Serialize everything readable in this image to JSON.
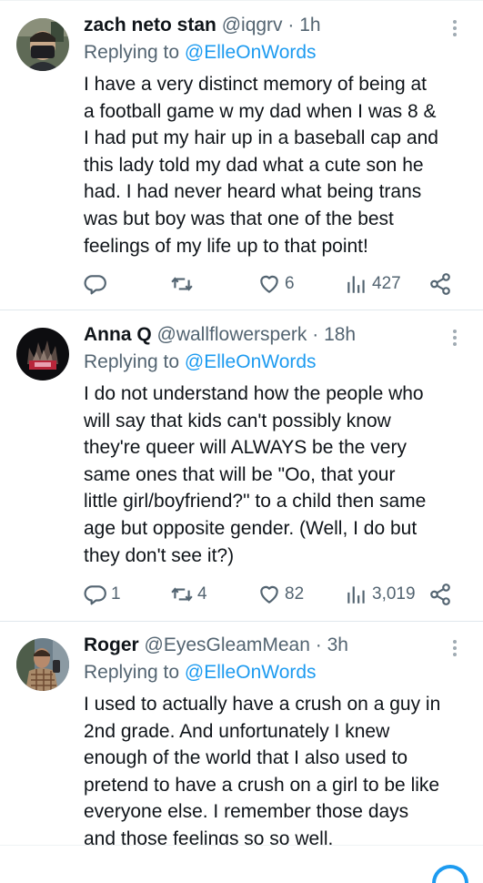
{
  "tweets": [
    {
      "name": "zach neto stan",
      "handle": "@iqgrv",
      "dot": "·",
      "time": "1h",
      "replying_prefix": "Replying to ",
      "replying_to": "@ElleOnWords",
      "body_lines": [
        "I have a very distinct memory of being at",
        "a football game w my dad when I was 8 &",
        "I had put my hair up in a baseball cap and",
        "this lady told my dad what a cute son he",
        "had. I had never heard what being trans",
        "was but boy was that one of the best",
        "feelings of my life up to that point!"
      ],
      "replies": "",
      "retweets": "",
      "likes": "6",
      "views": "427"
    },
    {
      "name": "Anna Q",
      "handle": "@wallflowersperk",
      "dot": "·",
      "time": "18h",
      "replying_prefix": "Replying to ",
      "replying_to": "@ElleOnWords",
      "body_lines": [
        "I do not understand how the people who",
        "will say that kids can't possibly know",
        "they're queer will ALWAYS be the very",
        "same ones that will be \"Oo, that your",
        "little girl/boyfriend?\" to a child then same",
        "age but opposite gender. (Well, I do but",
        "they don't see it?)"
      ],
      "replies": "1",
      "retweets": "4",
      "likes": "82",
      "views": "3,019"
    },
    {
      "name": "Roger",
      "handle": "@EyesGleamMean",
      "dot": "·",
      "time": "3h",
      "replying_prefix": "Replying to ",
      "replying_to": "@ElleOnWords",
      "body_lines": [
        "I used to actually have a crush on a guy in",
        "2nd grade. And unfortunately I knew",
        "enough of the world that I also used to",
        "pretend to have a crush on a girl to be like",
        "everyone else. I remember those days",
        "and those feelings so so well."
      ]
    }
  ],
  "icons": {
    "reply": "reply-icon",
    "retweet": "retweet-icon",
    "like": "heart-icon",
    "views": "views-icon",
    "share": "share-icon",
    "more": "more-icon"
  },
  "colors": {
    "text": "#0f1419",
    "muted": "#536471",
    "link": "#1d9bf0",
    "divider": "#e1e8ed"
  }
}
